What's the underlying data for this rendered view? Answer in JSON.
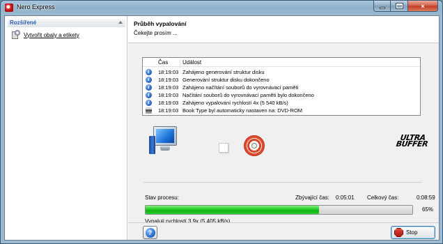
{
  "window": {
    "title": "Nero Express",
    "controls": {
      "minimize": "minimize-icon",
      "maximize": "maximize-icon",
      "close": "×"
    }
  },
  "sidebar": {
    "header": "Rozšířené",
    "items": [
      {
        "label": "Vytvořit obaly a etikety",
        "icon": "cover-label-icon"
      }
    ]
  },
  "main": {
    "title": "Průběh vypalování",
    "subtitle": "Čekejte prosím ..."
  },
  "log": {
    "columns": {
      "time": "Čas",
      "event": "Událost"
    },
    "rows": [
      {
        "icon": "info",
        "time": "18:19:03",
        "event": "Zahájeno generování struktur disku"
      },
      {
        "icon": "info",
        "time": "18:19:03",
        "event": "Generování struktur disku dokončeno"
      },
      {
        "icon": "info",
        "time": "18:19:03",
        "event": "Zahájeno načítání souborů do vyrovnávací paměti"
      },
      {
        "icon": "info",
        "time": "18:19:03",
        "event": "Načítání souborů do vyrovnávací paměti bylo dokončeno"
      },
      {
        "icon": "info",
        "time": "18:19:03",
        "event": "Zahájeno vypalování rychlostí 4x (5 540 kB/s)"
      },
      {
        "icon": "printer",
        "time": "18:19:03",
        "event": "Book Type byl automaticky nastaven na: DVD-ROM"
      }
    ]
  },
  "graphics": {
    "logo_line1": "ULTRA",
    "logo_line2": "BUFFER"
  },
  "status": {
    "state_label": "Stav procesu:",
    "remaining_label": "Zbývající čas:",
    "remaining_value": "0:05:01",
    "total_label": "Celkový čas:",
    "total_value": "0:08:59",
    "progress_percent": 65,
    "progress_text": "65%",
    "speed_text": "Vypaluji rychlostí 3.9x (5 405 kB/s)"
  },
  "footer": {
    "help_icon": "?",
    "stop_label": "Stop"
  },
  "colors": {
    "progress": "#22c322",
    "accent": "#2a5db0",
    "stop": "#c0281a"
  }
}
